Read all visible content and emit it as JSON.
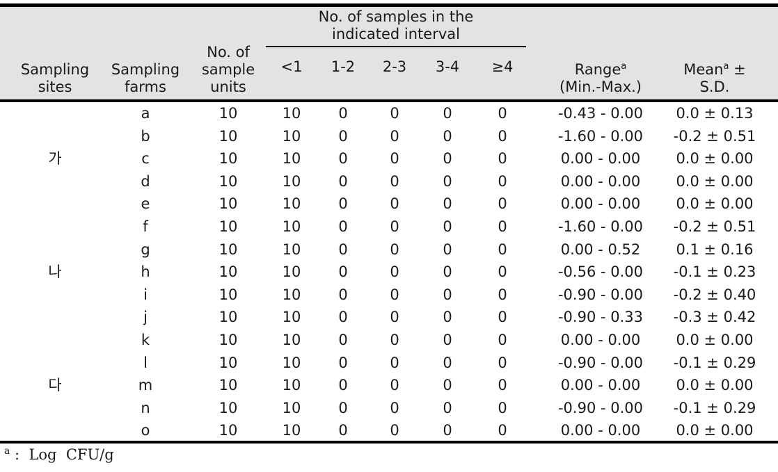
{
  "table": {
    "header": {
      "sampling_sites": "Sampling\nsites",
      "sampling_sites_l1": "Sampling",
      "sampling_sites_l2": "sites",
      "sampling_farms_l1": "Sampling",
      "sampling_farms_l2": "farms",
      "sample_units_l1": "No. of",
      "sample_units_l2": "sample",
      "sample_units_l3": "units",
      "interval_span_l1": "No. of samples in the",
      "interval_span_l2": "indicated interval",
      "intervals": [
        "<1",
        "1-2",
        "2-3",
        "3-4",
        "≥4"
      ],
      "range_l1": "Range",
      "range_sup": "a",
      "range_l2": "(Min.-Max.)",
      "mean_l1": "Mean",
      "mean_sup": "a",
      "mean_pm": " ±",
      "mean_l2": "S.D."
    },
    "rows": [
      {
        "site": "",
        "farm": "a",
        "units": "10",
        "i1": "10",
        "i2": "0",
        "i3": "0",
        "i4": "0",
        "i5": "0",
        "range": "-0.43 -  0.00",
        "mean": "0.0 ± 0.13"
      },
      {
        "site": "",
        "farm": "b",
        "units": "10",
        "i1": "10",
        "i2": "0",
        "i3": "0",
        "i4": "0",
        "i5": "0",
        "range": "-1.60 -  0.00",
        "mean": "-0.2 ± 0.51"
      },
      {
        "site": "가",
        "farm": "c",
        "units": "10",
        "i1": "10",
        "i2": "0",
        "i3": "0",
        "i4": "0",
        "i5": "0",
        "range": "0.00 -  0.00",
        "mean": "0.0 ± 0.00"
      },
      {
        "site": "",
        "farm": "d",
        "units": "10",
        "i1": "10",
        "i2": "0",
        "i3": "0",
        "i4": "0",
        "i5": "0",
        "range": "0.00 -  0.00",
        "mean": "0.0 ± 0.00"
      },
      {
        "site": "",
        "farm": "e",
        "units": "10",
        "i1": "10",
        "i2": "0",
        "i3": "0",
        "i4": "0",
        "i5": "0",
        "range": "0.00 -  0.00",
        "mean": "0.0 ± 0.00"
      },
      {
        "site": "",
        "farm": "f",
        "units": "10",
        "i1": "10",
        "i2": "0",
        "i3": "0",
        "i4": "0",
        "i5": "0",
        "range": "-1.60 -  0.00",
        "mean": "-0.2 ± 0.51"
      },
      {
        "site": "",
        "farm": "g",
        "units": "10",
        "i1": "10",
        "i2": "0",
        "i3": "0",
        "i4": "0",
        "i5": "0",
        "range": "0.00 -  0.52",
        "mean": "0.1 ± 0.16"
      },
      {
        "site": "나",
        "farm": "h",
        "units": "10",
        "i1": "10",
        "i2": "0",
        "i3": "0",
        "i4": "0",
        "i5": "0",
        "range": "-0.56 -  0.00",
        "mean": "-0.1 ± 0.23"
      },
      {
        "site": "",
        "farm": "i",
        "units": "10",
        "i1": "10",
        "i2": "0",
        "i3": "0",
        "i4": "0",
        "i5": "0",
        "range": "-0.90 -  0.00",
        "mean": "-0.2 ± 0.40"
      },
      {
        "site": "",
        "farm": "j",
        "units": "10",
        "i1": "10",
        "i2": "0",
        "i3": "0",
        "i4": "0",
        "i5": "0",
        "range": "-0.90 -  0.33",
        "mean": "-0.3 ± 0.42"
      },
      {
        "site": "",
        "farm": "k",
        "units": "10",
        "i1": "10",
        "i2": "0",
        "i3": "0",
        "i4": "0",
        "i5": "0",
        "range": "0.00 -  0.00",
        "mean": "0.0 ± 0.00"
      },
      {
        "site": "",
        "farm": "l",
        "units": "10",
        "i1": "10",
        "i2": "0",
        "i3": "0",
        "i4": "0",
        "i5": "0",
        "range": "-0.90 -  0.00",
        "mean": "-0.1 ± 0.29"
      },
      {
        "site": "다",
        "farm": "m",
        "units": "10",
        "i1": "10",
        "i2": "0",
        "i3": "0",
        "i4": "0",
        "i5": "0",
        "range": "0.00 -  0.00",
        "mean": "0.0 ± 0.00"
      },
      {
        "site": "",
        "farm": "n",
        "units": "10",
        "i1": "10",
        "i2": "0",
        "i3": "0",
        "i4": "0",
        "i5": "0",
        "range": "-0.90 -  0.00",
        "mean": "-0.1 ± 0.29"
      },
      {
        "site": "",
        "farm": "o",
        "units": "10",
        "i1": "10",
        "i2": "0",
        "i3": "0",
        "i4": "0",
        "i5": "0",
        "range": "0.00 -  0.00",
        "mean": "0.0 ± 0.00"
      }
    ],
    "footnote": {
      "sup": "a",
      "text": " :  Log  CFU/g"
    },
    "colors": {
      "header_background": "#e3e3e3",
      "rule": "#000000",
      "text": "#1a1a1a",
      "page_background": "#ffffff"
    }
  }
}
